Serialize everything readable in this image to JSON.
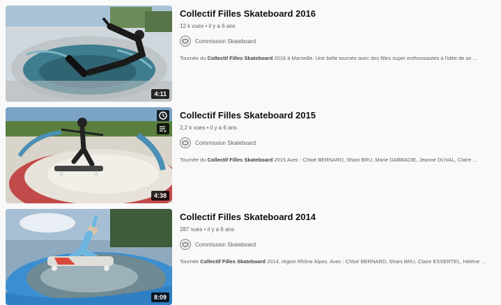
{
  "videos": [
    {
      "title": "Collectif Filles Skateboard 2016",
      "views": "12 k vues",
      "age": "il y a 6 ans",
      "channel": "Commission Skateboard",
      "desc_pre": "Tournée du ",
      "desc_bold": "Collectif Filles Skateboard",
      "desc_post": " 2016 à Marseille. Une belle tournée avec des filles super enthousiastes à l'idée de se ...",
      "duration": "4:11"
    },
    {
      "title": "Collectif Filles Skateboard 2015",
      "views": "2,2 k vues",
      "age": "il y a 6 ans",
      "channel": "Commission Skateboard",
      "desc_pre": "Tournée du ",
      "desc_bold": "Collectif Filles Skateboard",
      "desc_post": " 2015 Avec : Chloé BERNARD, Shani BRU, Marie DABBADIE, Jeanne DUVAL, Claire ...",
      "duration": "4:38"
    },
    {
      "title": "Collectif Filles Skateboard 2014",
      "views": "287 vues",
      "age": "il y a 6 ans",
      "channel": "Commission Skateboard",
      "desc_pre": "Tournée ",
      "desc_bold": "Collectif Filles Skateboard",
      "desc_post": " 2014, région Rhône Alpes. Avec : Chloé BERNARD, Shani BRU, Claire ESSERTEL, Hélène ...",
      "duration": "8:09"
    }
  ],
  "separator": "•",
  "icons": {
    "watch_later": "clock-icon",
    "add_to_queue": "queue-icon",
    "channel_avatar": "channel-logo-icon"
  },
  "colors": {
    "background": "#f9f9f9",
    "title": "#0f0f0f",
    "secondary": "#606060"
  }
}
